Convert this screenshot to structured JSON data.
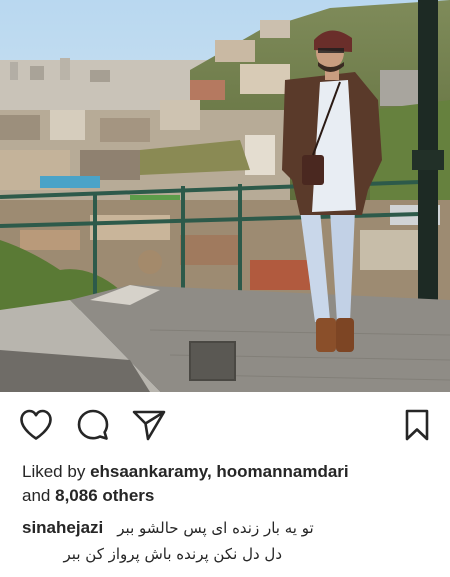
{
  "post": {
    "photo_alt": "photo",
    "actions": {
      "like_icon": "heart-outline-icon",
      "comment_icon": "comment-bubble-icon",
      "share_icon": "paper-plane-icon",
      "save_icon": "bookmark-outline-icon"
    },
    "likes": {
      "prefix": "Liked by",
      "user1": "ehsaankaramy",
      "separator": ", ",
      "user2": "hoomannamdari",
      "and_text": "and",
      "others_count": "8,086",
      "others_label": "others"
    },
    "caption": {
      "username": "sinahejazi",
      "line1": "تو یه بار زنده ای پس حالشو ببر",
      "line2": "دل دل نکن پرنده باش پرواز کن ببر"
    }
  },
  "colors": {
    "text": "#262626",
    "background": "#ffffff"
  }
}
